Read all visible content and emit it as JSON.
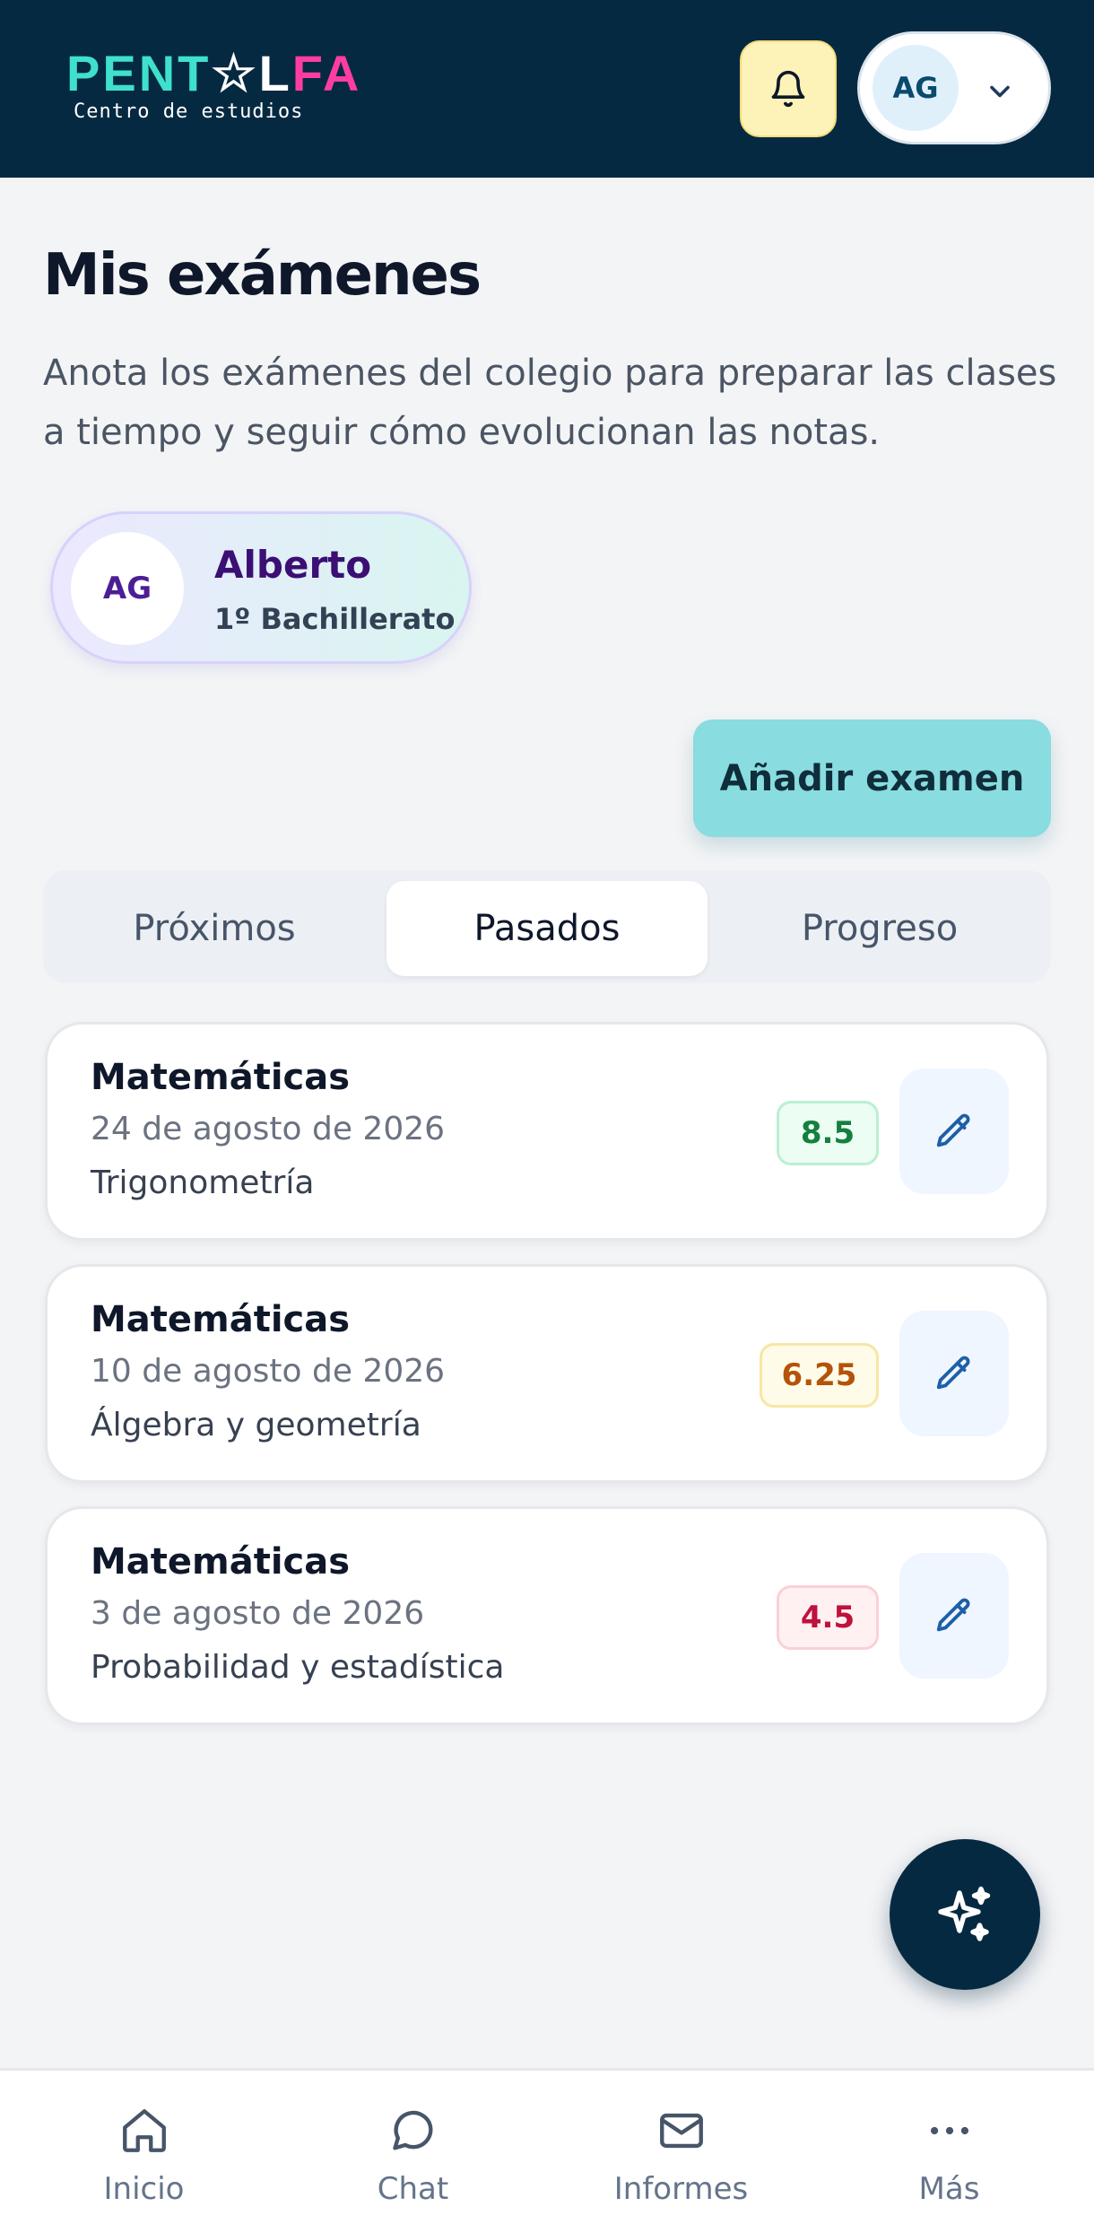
{
  "header": {
    "logo": {
      "word_start": "PENT",
      "word_mid": "☆L",
      "word_end": "FA",
      "subtitle": "Centro de estudios"
    },
    "notifications_icon": "bell-icon",
    "user": {
      "initials": "AG",
      "menu_icon": "chevron-down-icon"
    }
  },
  "page": {
    "title": "Mis exámenes",
    "description": "Anota los exámenes del colegio para preparar las clases a tiempo y seguir cómo evolucionan las notas."
  },
  "student": {
    "initials": "AG",
    "name": "Alberto",
    "course": "1º Bachillerato"
  },
  "actions": {
    "add_exam": "Añadir examen"
  },
  "tabs": [
    {
      "label": "Próximos",
      "active": false
    },
    {
      "label": "Pasados",
      "active": true
    },
    {
      "label": "Progreso",
      "active": false
    }
  ],
  "exams": [
    {
      "subject": "Matemáticas",
      "date": "24 de agosto de 2026",
      "topic": "Trigonometría",
      "grade": "8.5",
      "grade_color": "#15803d"
    },
    {
      "subject": "Matemáticas",
      "date": "10 de agosto de 2026",
      "topic": "Álgebra y geometría",
      "grade": "6.25",
      "grade_color": "#b45309"
    },
    {
      "subject": "Matemáticas",
      "date": "3 de agosto de 2026",
      "topic": "Probabilidad y estadística",
      "grade": "4.5",
      "grade_color": "#be123c"
    }
  ],
  "fab": {
    "icon": "sparkles-icon"
  },
  "bottom_nav": [
    {
      "label": "Inicio",
      "icon": "home-icon"
    },
    {
      "label": "Chat",
      "icon": "chat-icon"
    },
    {
      "label": "Informes",
      "icon": "mail-icon"
    },
    {
      "label": "Más",
      "icon": "more-icon"
    }
  ],
  "colors": {
    "header_bg": "#062942",
    "accent": "#89dcdf",
    "grade_high": "#15803d",
    "grade_mid": "#b45309",
    "grade_low": "#be123c"
  }
}
